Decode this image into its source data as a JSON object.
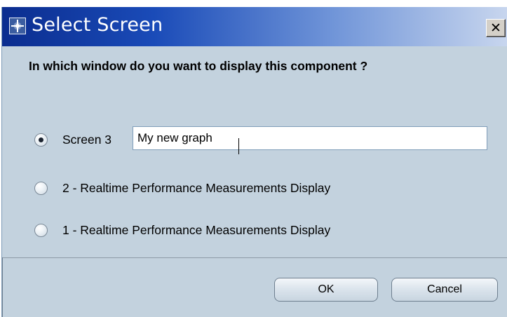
{
  "dialog": {
    "title": "Select Screen",
    "close_glyph": "✕",
    "question": "In which window do you want to  display this component ?"
  },
  "options": [
    {
      "label": "Screen 3",
      "checked": true
    },
    {
      "label": "2 - Realtime Performance Measurements Display",
      "checked": false
    },
    {
      "label": "1 - Realtime Performance Measurements Display",
      "checked": false
    }
  ],
  "screen_name_input": {
    "value": "My new graph"
  },
  "buttons": {
    "ok_label": "OK",
    "cancel_label": "Cancel"
  },
  "icons": {
    "title": "app-icon",
    "close": "close-icon"
  },
  "colors": {
    "dialog_background": "#c3d2de",
    "titlebar_start": "#0b2d8f",
    "titlebar_end": "#c8d6ee"
  }
}
